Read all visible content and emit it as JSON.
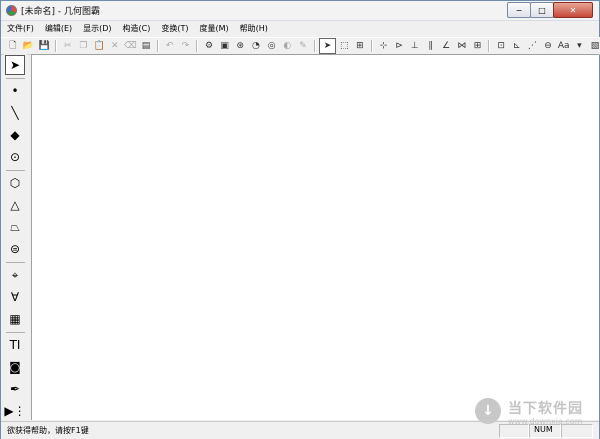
{
  "window": {
    "title": "[未命名] - 几何图霸"
  },
  "caption": {
    "minimize": "−",
    "maximize": "□",
    "close": "✕"
  },
  "menu": [
    "文件(F)",
    "编辑(E)",
    "显示(D)",
    "构造(C)",
    "变换(T)",
    "度量(M)",
    "帮助(H)"
  ],
  "toolbar": {
    "groups": [
      [
        {
          "name": "new-file-icon",
          "glyph": "🗋"
        },
        {
          "name": "open-folder-icon",
          "glyph": "📂"
        },
        {
          "name": "save-icon",
          "glyph": "💾"
        }
      ],
      [
        {
          "name": "cut-icon",
          "glyph": "✂",
          "disabled": true
        },
        {
          "name": "copy-icon",
          "glyph": "❐",
          "disabled": true
        },
        {
          "name": "paste-icon",
          "glyph": "📋",
          "disabled": true
        },
        {
          "name": "delete-icon",
          "glyph": "✕",
          "disabled": true
        },
        {
          "name": "erase-icon",
          "glyph": "⌫",
          "disabled": true
        },
        {
          "name": "properties-icon",
          "glyph": "▤"
        }
      ],
      [
        {
          "name": "undo-icon",
          "glyph": "↶",
          "disabled": true
        },
        {
          "name": "redo-icon",
          "glyph": "↷",
          "disabled": true
        }
      ],
      [
        {
          "name": "settings-icon",
          "glyph": "⚙"
        },
        {
          "name": "camera-icon",
          "glyph": "▣"
        },
        {
          "name": "zoom-icon",
          "glyph": "⊛"
        },
        {
          "name": "animate-icon",
          "glyph": "◔"
        },
        {
          "name": "trace-icon",
          "glyph": "◎"
        },
        {
          "name": "color-icon",
          "glyph": "◐",
          "disabled": true
        },
        {
          "name": "brush-icon",
          "glyph": "✎",
          "disabled": true
        }
      ],
      [
        {
          "name": "select-arrow-icon",
          "glyph": "➤",
          "selected": true
        },
        {
          "name": "select-area-icon",
          "glyph": "⬚"
        },
        {
          "name": "select-points-icon",
          "glyph": "⊞"
        }
      ],
      [
        {
          "name": "point-on-icon",
          "glyph": "⊹"
        },
        {
          "name": "midpoint-icon",
          "glyph": "⊳"
        },
        {
          "name": "perpendicular-icon",
          "glyph": "⊥"
        },
        {
          "name": "parallel-icon",
          "glyph": "∥"
        },
        {
          "name": "bisector-icon",
          "glyph": "∠"
        },
        {
          "name": "reflect-icon",
          "glyph": "⋈"
        },
        {
          "name": "grid-icon",
          "glyph": "⊞"
        }
      ],
      [
        {
          "name": "frame-icon",
          "glyph": "⊡"
        },
        {
          "name": "axes-icon",
          "glyph": "⊾"
        },
        {
          "name": "dotted-line-icon",
          "glyph": "⋰"
        },
        {
          "name": "ellipse-icon",
          "glyph": "⊖"
        },
        {
          "name": "font-icon",
          "glyph": "Aa"
        },
        {
          "name": "dropdown-arrow-icon",
          "glyph": "▾"
        },
        {
          "name": "image-icon",
          "glyph": "▧"
        }
      ]
    ]
  },
  "tools": [
    {
      "name": "arrow-tool-icon",
      "glyph": "➤",
      "selected": true
    },
    {
      "sep": true
    },
    {
      "name": "point-tool-icon",
      "glyph": "•"
    },
    {
      "name": "segment-tool-icon",
      "glyph": "╲"
    },
    {
      "name": "polygon-tool-icon",
      "glyph": "◆"
    },
    {
      "name": "circle-tool-icon",
      "glyph": "⊙"
    },
    {
      "sep": true
    },
    {
      "name": "cube-tool-icon",
      "glyph": "⬡"
    },
    {
      "name": "pyramid-tool-icon",
      "glyph": "△"
    },
    {
      "name": "prism-tool-icon",
      "glyph": "⏢"
    },
    {
      "name": "sphere-tool-icon",
      "glyph": "⊜"
    },
    {
      "sep": true
    },
    {
      "name": "transform-tool-icon",
      "glyph": "⌖"
    },
    {
      "name": "angle-tool-icon",
      "glyph": "∀"
    },
    {
      "name": "calculator-tool-icon",
      "glyph": "▦"
    },
    {
      "sep": true
    },
    {
      "name": "text-tool-icon",
      "glyph": "TI"
    },
    {
      "name": "image-tool-icon",
      "glyph": "◙"
    },
    {
      "name": "pen-tool-icon",
      "glyph": "✒"
    },
    {
      "name": "more-tools-icon",
      "glyph": "▶⋮"
    }
  ],
  "status": {
    "help": "欲获得帮助，请按F1键",
    "num": "NUM"
  },
  "watermark": {
    "cn": "当下软件园",
    "en": "www.downxia.com",
    "icon": "↓"
  }
}
